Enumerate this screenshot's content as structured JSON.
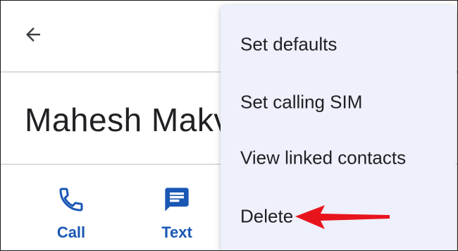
{
  "header": {
    "back_icon": "arrow-back-icon"
  },
  "contact": {
    "name": "Mahesh Makv"
  },
  "actions": [
    {
      "label": "Call",
      "icon": "phone-icon"
    },
    {
      "label": "Text",
      "icon": "message-icon"
    }
  ],
  "menu": {
    "items": [
      {
        "label": "Set defaults"
      },
      {
        "label": "Set calling SIM"
      },
      {
        "label": "View linked contacts"
      },
      {
        "label": "Delete"
      }
    ]
  },
  "colors": {
    "accent": "#1a57b4",
    "menu_background": "#eef0fb",
    "annotation_arrow": "#e8141c",
    "text_primary": "#202124",
    "divider": "#dadce0"
  }
}
